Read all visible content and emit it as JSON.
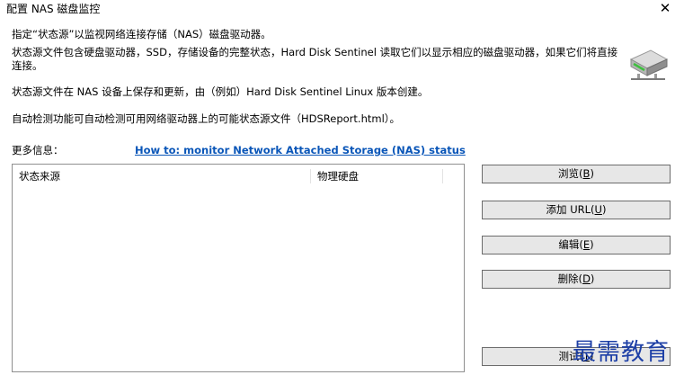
{
  "window": {
    "title": "配置 NAS 磁盘监控",
    "close_glyph": "✕"
  },
  "info": {
    "line1": "指定“状态源”以监视网络连接存储（NAS）磁盘驱动器。",
    "line2": "状态源文件包含硬盘驱动器，SSD，存储设备的完整状态，Hard Disk Sentinel 读取它们以显示相应的磁盘驱动器，如果它们将直接连接。",
    "line3": "状态源文件在 NAS 设备上保存和更新，由（例如）Hard Disk Sentinel Linux 版本创建。",
    "line4": "自动检测功能可自动检测可用网络驱动器上的可能状态源文件（HDSReport.html）。",
    "more_info_label": "更多信息：",
    "more_info_link": "How to: monitor Network Attached Storage (NAS) status"
  },
  "list": {
    "columns": [
      "状态来源",
      "物理硬盘"
    ],
    "rows": []
  },
  "buttons": {
    "browse": {
      "label": "浏览(",
      "key": "B",
      "end": ")"
    },
    "add_url": {
      "label": "添加 URL(",
      "key": "U",
      "end": ")"
    },
    "edit": {
      "label": "编辑(",
      "key": "E",
      "end": ")"
    },
    "delete": {
      "label": "删除(",
      "key": "D",
      "end": ")"
    },
    "test": {
      "label": "测试(",
      "key": "T",
      "end": ")"
    }
  },
  "icons": {
    "drive": "network-drive-icon",
    "close": "close-icon"
  },
  "watermark": "最需教育"
}
